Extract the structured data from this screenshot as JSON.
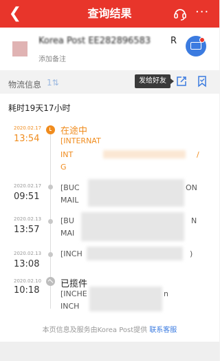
{
  "header": {
    "back_icon": "chevron-left-icon",
    "title": "查询结果",
    "support_icon": "headset-icon",
    "more_label": "···"
  },
  "card": {
    "tracking_prefix": "Korea Post",
    "tracking_number_blurred": "EE282896583",
    "tracking_suffix": "R",
    "remark": "添加备注",
    "mail_icon": "envelope-icon",
    "accent_color": "#3b7be0"
  },
  "section": {
    "label": "物流信息",
    "sort_label": "1⇅",
    "tooltip": "发给好友",
    "share_icon": "share-icon",
    "bookmark_icon": "bookmark-icon"
  },
  "timeline": {
    "elapsed": "耗时19天17小时",
    "events": [
      {
        "date": "2020.02.17",
        "time": "13:54",
        "status": "在途中",
        "lines": [
          "[INTERNAT",
          "INT",
          "G"
        ],
        "line_tail": "/"
      },
      {
        "date": "2020.02.17",
        "time": "09:51",
        "lines": [
          "[BUC",
          "MAIL"
        ],
        "tail_1": "ON",
        "tail_2": "/"
      },
      {
        "date": "2020.02.13",
        "time": "13:57",
        "lines": [
          "[BU",
          "MAI"
        ],
        "tail_1": "N",
        "tail_2": ")"
      },
      {
        "date": "2020.02.13",
        "time": "13:08",
        "lines": [
          "[INCH"
        ],
        "tail_1": ")"
      },
      {
        "date": "2020.02.10",
        "time": "10:18",
        "status": "已揽件",
        "lines": [
          "[INCHE",
          "INCH"
        ],
        "tail_1": "n"
      }
    ]
  },
  "footer": {
    "text": "本页信息及服务由Korea Post提供",
    "link": "联系客服"
  },
  "colors": {
    "header_red": "#e8352b",
    "active_orange": "#f08c1e",
    "link_blue": "#3b7be0"
  }
}
